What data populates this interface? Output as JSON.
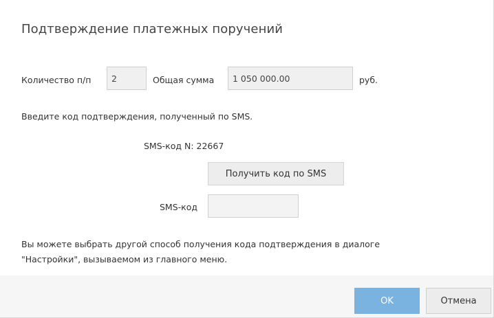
{
  "dialog": {
    "title": "Подтверждение платежных поручений",
    "count_label": "Количество п/п",
    "count_value": "2",
    "sum_label": "Общая сумма",
    "sum_value": "1 050 000.00",
    "currency_label": "руб.",
    "instruction": "Введите код подтверждения, полученный по SMS.",
    "sms_number_label": "SMS-код N: 22667",
    "get_code_button": "Получить код по SMS",
    "sms_code_label": "SMS-код",
    "sms_code_value": "",
    "note_line1": "Вы можете выбрать другой способ получения кода подтверждения в диалоге",
    "note_line2": "\"Настройки\", вызываемом из главного меню."
  },
  "footer": {
    "ok_label": "OK",
    "cancel_label": "Отмена"
  },
  "colors": {
    "ok_button": "#7ab2e0",
    "footer_background": "#f6f6f6",
    "field_background": "#f0f0f0"
  }
}
